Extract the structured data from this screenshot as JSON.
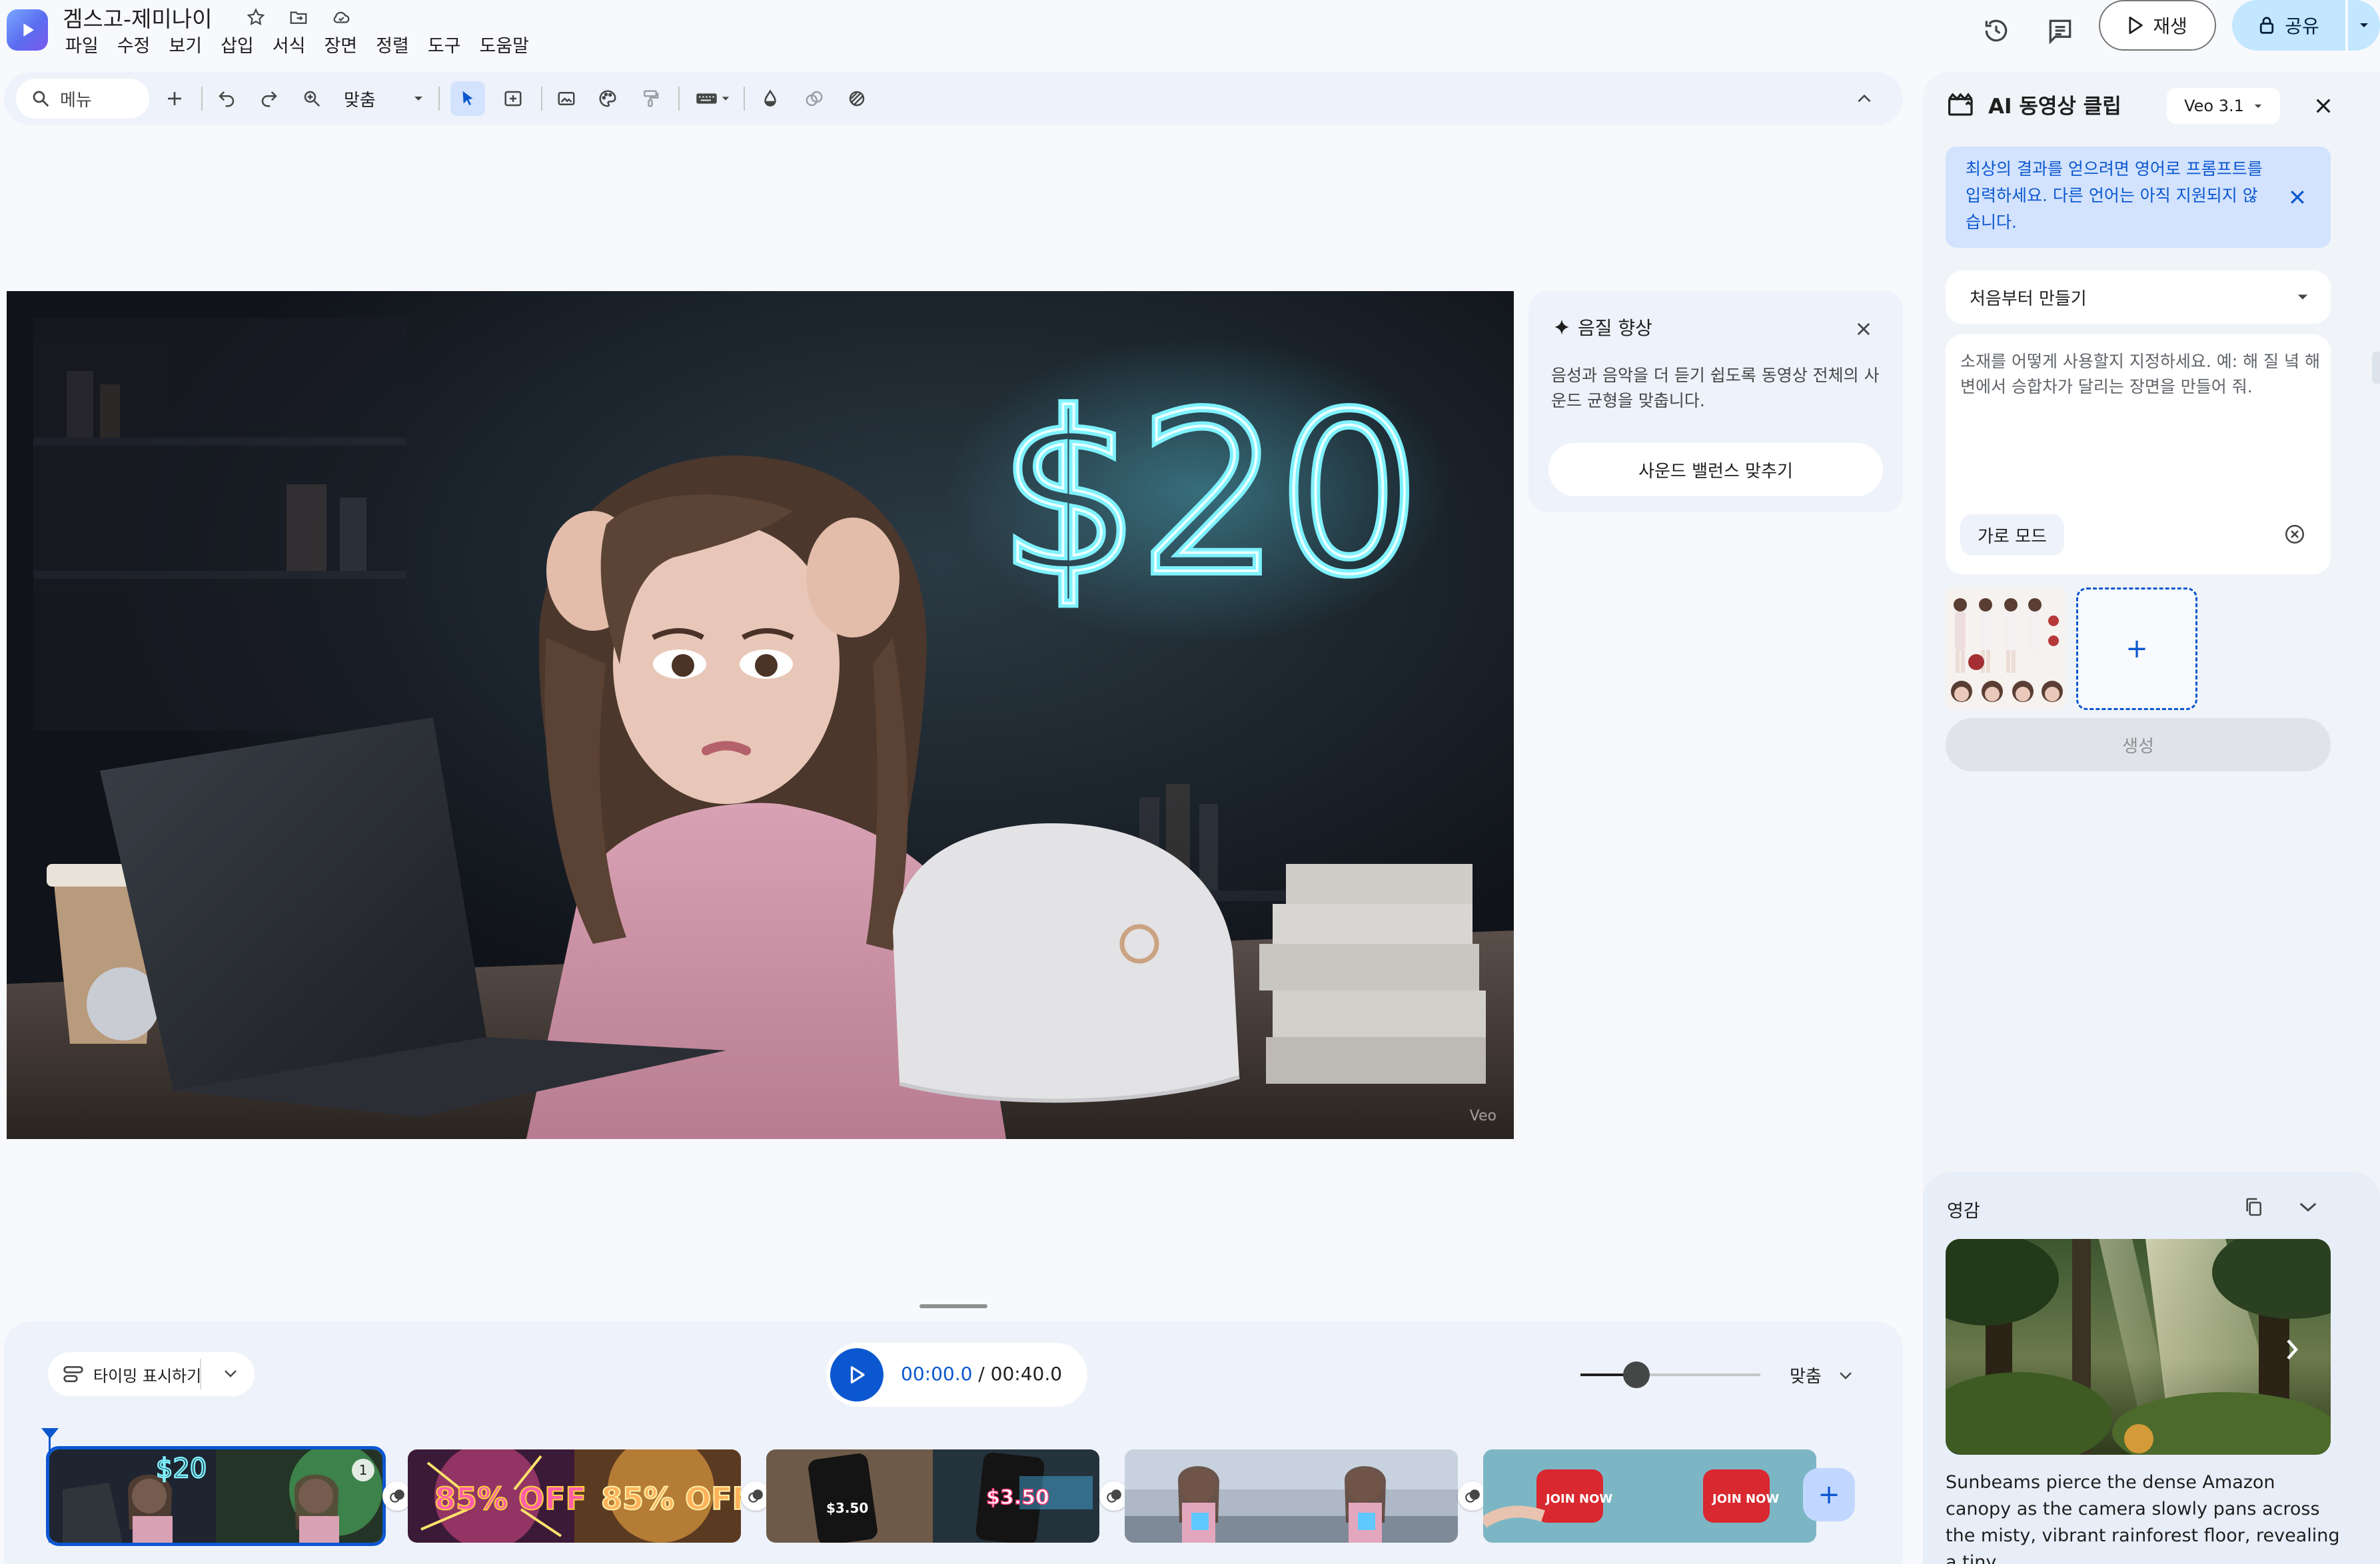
{
  "app": {
    "title": "겜스고-제미나이",
    "menus": [
      "파일",
      "수정",
      "보기",
      "삽입",
      "서식",
      "장면",
      "정렬",
      "도구",
      "도움말"
    ],
    "play_label": "재생",
    "share_label": "공유"
  },
  "toolbar": {
    "search_label": "메뉴",
    "zoom_label": "맞춤"
  },
  "canvas": {
    "headline": "$20",
    "watermark": "Veo"
  },
  "audio_card": {
    "title": "음질 향상",
    "description": "음성과 음악을 더 듣기 쉽도록 동영상 전체의 사운드 균형을 맞춥니다.",
    "action_label": "사운드 밸런스 맞추기"
  },
  "side_panel": {
    "title": "AI 동영상 클립",
    "model": "Veo 3.1",
    "notice": "최상의 결과를 얻으려면 영어로 프롬프트를 입력하세요. 다른 언어는 아직 지원되지 않습니다.",
    "mode": "처음부터 만들기",
    "prompt_placeholder": "소재를 어떻게 사용할지 지정하세요. 예: 해 질 녘 해변에서 승합차가 달리는 장면을 만들어 줘.",
    "orientation": "가로 모드",
    "add_reference": "+",
    "generate_label": "생성",
    "inspiration": {
      "label": "영감",
      "text": "Sunbeams pierce the dense Amazon canopy as the camera slowly pans across the misty, vibrant rainforest floor, revealing a tiny,..."
    }
  },
  "timeline": {
    "timing_label": "타이밍 표시하기",
    "time_current": "00:00.0",
    "time_separator": " / ",
    "time_total": "00:40.0",
    "zoom_label": "맞춤",
    "selected_clip_badge": "1",
    "zoom_level": 0.25,
    "clips": [
      {
        "name": "clip-1",
        "overlay": "$20"
      },
      {
        "name": "clip-2",
        "overlay": "85% OFF"
      },
      {
        "name": "clip-3",
        "overlay": "$3.50"
      },
      {
        "name": "clip-4",
        "overlay": ""
      },
      {
        "name": "clip-5",
        "overlay": "JOIN NOW"
      }
    ],
    "add_clip": "+"
  },
  "colors": {
    "accent": "#0b57d0",
    "share_bg": "#c2e7ff",
    "neon": "#7ff2ff"
  }
}
